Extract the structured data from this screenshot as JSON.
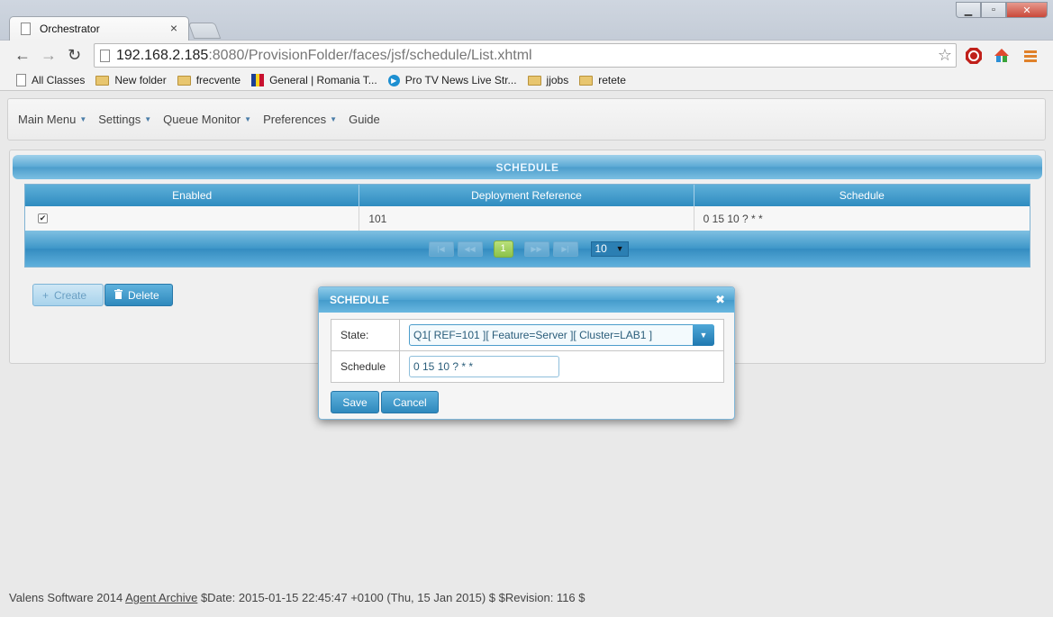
{
  "browser": {
    "tab_title": "Orchestrator",
    "tab_close": "×",
    "url_host": "192.168.2.185",
    "url_rest": ":8080/ProvisionFolder/faces/jsf/schedule/List.xhtml",
    "window_buttons": {
      "minimize": "▁",
      "maximize": "▫",
      "close": "✕"
    },
    "nav": {
      "back": "←",
      "forward": "→",
      "reload": "↻"
    },
    "star": "☆",
    "bookmarks": [
      {
        "label": "All Classes",
        "icon": "page-icon"
      },
      {
        "label": "New folder",
        "icon": "folder-icon"
      },
      {
        "label": "frecvente",
        "icon": "folder-icon"
      },
      {
        "label": "General | Romania T...",
        "icon": "flag-icon"
      },
      {
        "label": "Pro TV News Live Str...",
        "icon": "circle-play-icon"
      },
      {
        "label": "jjobs",
        "icon": "folder-icon"
      },
      {
        "label": "retete",
        "icon": "folder-icon"
      }
    ]
  },
  "menu": [
    {
      "label": "Main Menu",
      "has_dropdown": true
    },
    {
      "label": "Settings",
      "has_dropdown": true
    },
    {
      "label": "Queue Monitor",
      "has_dropdown": true
    },
    {
      "label": "Preferences",
      "has_dropdown": true
    },
    {
      "label": "Guide",
      "has_dropdown": false
    }
  ],
  "panel": {
    "title": "SCHEDULE",
    "columns": [
      "Enabled",
      "Deployment Reference",
      "Schedule"
    ],
    "rows": [
      {
        "enabled": true,
        "enabled_mark": "✔",
        "reference": "101",
        "schedule": "0 15 10 ? * *"
      }
    ],
    "paginator": {
      "first": "|◀",
      "prev": "◀◀",
      "next": "▶▶",
      "last": "▶|",
      "current_page": "1",
      "rows_per_page": "10",
      "dropdown_caret": "▼"
    }
  },
  "actions": {
    "create_label": "Create",
    "create_icon": "+",
    "delete_label": "Delete",
    "delete_icon": "🗑"
  },
  "footer": {
    "prefix": "Valens Software 2014 ",
    "link": "Agent Archive",
    "suffix": " $Date: 2015-01-15 22:45:47 +0100 (Thu, 15 Jan 2015) $ $Revision: 116 $"
  },
  "dialog": {
    "title": "SCHEDULE",
    "close": "✖",
    "state_label": "State:",
    "state_value": "Q1[ REF=101 ][ Feature=Server ][ Cluster=LAB1 ]",
    "schedule_label": "Schedule",
    "schedule_value": "0 15 10 ? * *",
    "save_label": "Save",
    "cancel_label": "Cancel"
  },
  "colors": {
    "accent": "#2f89bd",
    "header_gradient_top": "#9fd0ea",
    "page_active": "#8cc24a"
  }
}
